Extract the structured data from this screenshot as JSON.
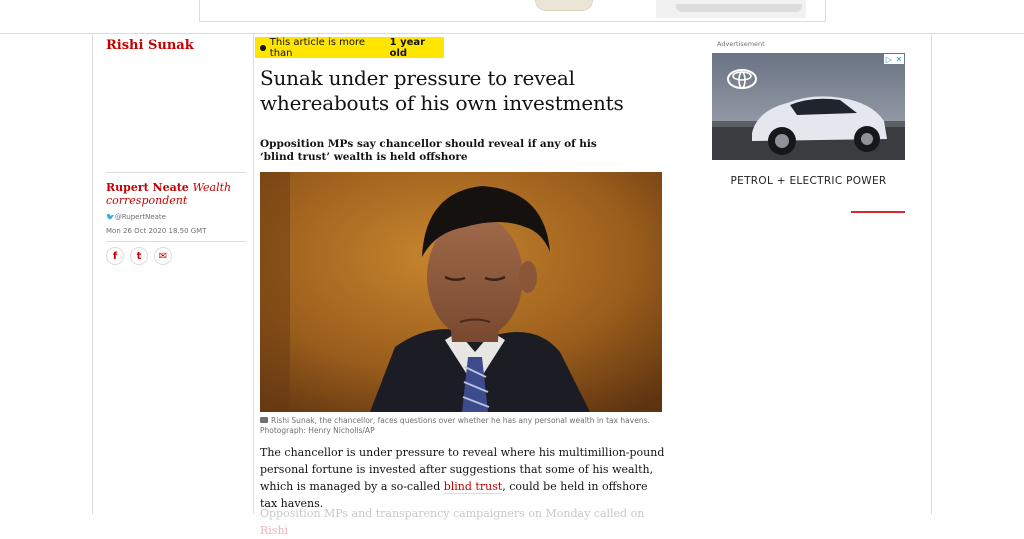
{
  "section": {
    "label": "Rishi Sunak"
  },
  "article": {
    "age_prefix": "This article is more than",
    "age_value": "1 year old",
    "headline": "Sunak under pressure to reveal whereabouts of his own investments",
    "standfirst": "Opposition MPs say chancellor should reveal if any of his ‘blind trust’ wealth is held offshore",
    "caption": "Rishi Sunak, the chancellor, faces questions over whether he has any personal wealth in tax havens. Photograph: Henry Nicholls/AP",
    "body_p1_a": "The chancellor is under pressure to reveal where his multimillion-pound personal fortune is invested after suggestions that some of his wealth, which is managed by a so-called ",
    "body_p1_link": "blind trust",
    "body_p1_b": ", could be held in offshore tax havens.",
    "body_p2_a": "Opposition MPs and transparency campaigners on Monday called on ",
    "body_p2_link": "Rishi"
  },
  "byline": {
    "author": "Rupert Neate",
    "role": "Wealth correspondent",
    "twitter": "@RupertNeate",
    "date": "Mon 26 Oct 2020 18.50 GMT"
  },
  "share": {
    "facebook": "f",
    "twitter": "t",
    "email": "✉"
  },
  "ad": {
    "label": "Advertisement",
    "caption": "PETROL + ELECTRIC POWER",
    "progress": 0.28
  },
  "colors": {
    "accent": "#c70000",
    "badge": "#ffe500",
    "rule": "#dcdcdc"
  }
}
